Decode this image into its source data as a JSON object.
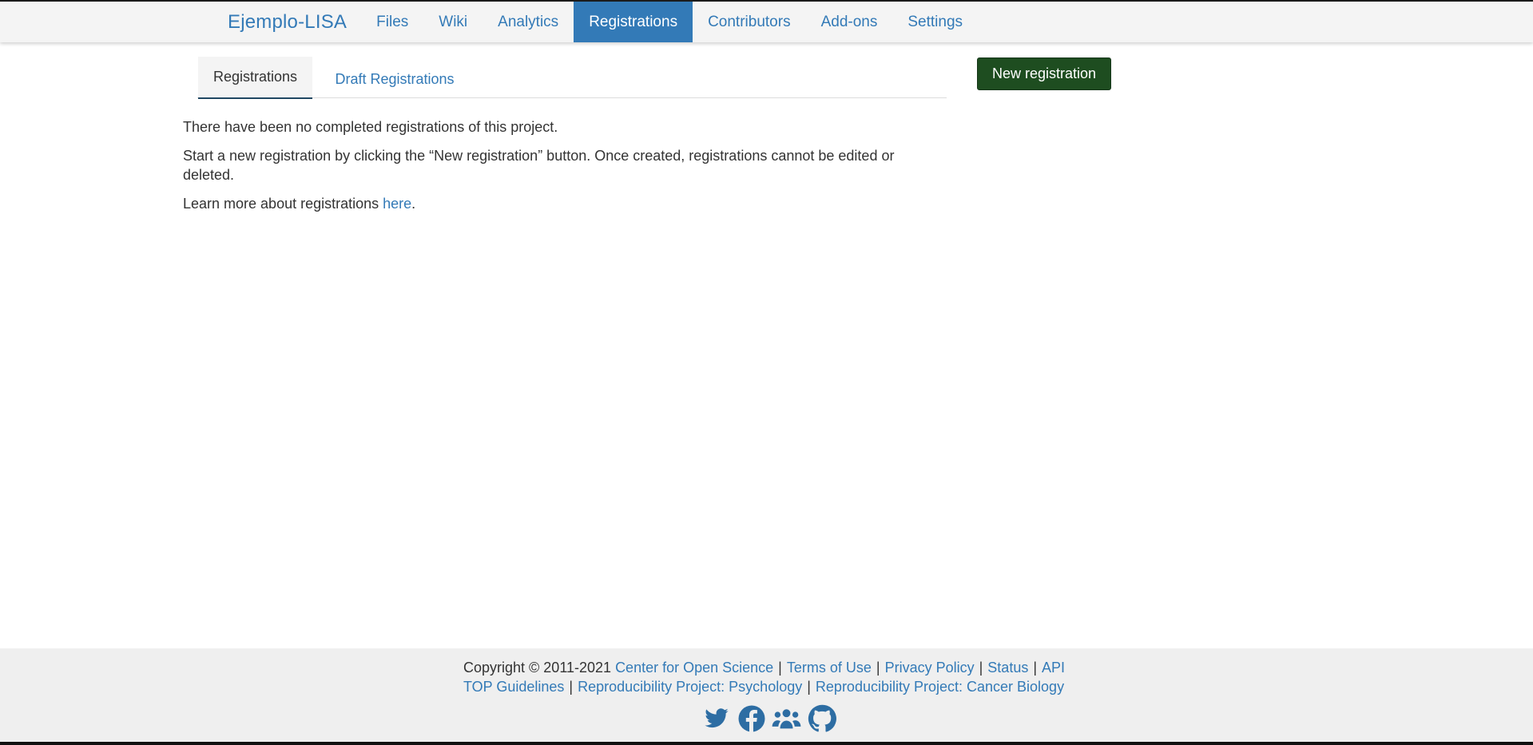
{
  "navbar": {
    "project_title": "Ejemplo-LISA",
    "links": [
      {
        "label": "Files"
      },
      {
        "label": "Wiki"
      },
      {
        "label": "Analytics"
      },
      {
        "label": "Registrations",
        "active": true
      },
      {
        "label": "Contributors"
      },
      {
        "label": "Add-ons"
      },
      {
        "label": "Settings"
      }
    ]
  },
  "tabs": {
    "registrations": "Registrations",
    "drafts": "Draft Registrations"
  },
  "actions": {
    "new_registration": "New registration"
  },
  "content": {
    "no_registrations": "There have been no completed registrations of this project.",
    "instructions": "Start a new registration by clicking the “New registration” button. Once created, registrations cannot be edited or deleted.",
    "learn_more_prefix": "Learn more about registrations ",
    "learn_more_link": "here",
    "learn_more_suffix": "."
  },
  "footer": {
    "copyright": "Copyright © 2011-2021",
    "links_line1": [
      "Center for Open Science",
      "Terms of Use",
      "Privacy Policy",
      "Status",
      "API"
    ],
    "links_line2": [
      "TOP Guidelines",
      "Reproducibility Project: Psychology",
      "Reproducibility Project: Cancer Biology"
    ],
    "separator": "|",
    "social_icons": [
      "twitter-icon",
      "facebook-icon",
      "group-icon",
      "github-icon"
    ]
  },
  "colors": {
    "link": "#337ab7",
    "active_nav_bg": "#337ab7",
    "primary_button": "#1e4d20",
    "footer_bg": "#efefef",
    "navbar_bg": "#f4f4f4"
  }
}
